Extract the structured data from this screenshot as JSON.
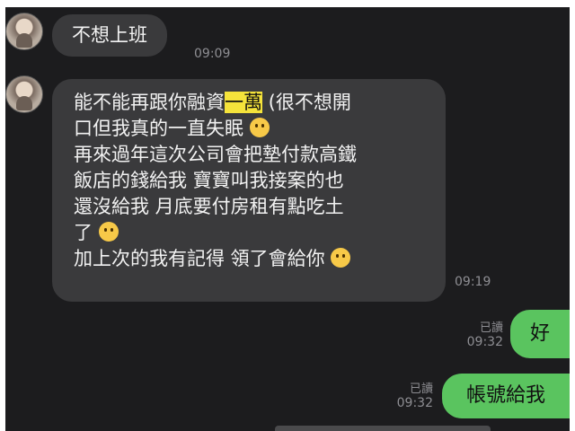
{
  "messages": {
    "m1": {
      "text": "不想上班",
      "time": "09:09"
    },
    "m2": {
      "line1_pre": "能不能再跟你融資",
      "line1_hl": "一萬",
      "line1_post": " (很不想開",
      "line2": "口但我真的一直失眠",
      "line3": "再來過年這次公司會把墊付款高鐵",
      "line4": "飯店的錢給我 寶寶叫我接案的也",
      "line5": "還沒給我 月底要付房租有點吃土",
      "line6": "了",
      "line7": "加上次的我有記得 領了會給你",
      "time": "09:19"
    },
    "m3": {
      "text": "好",
      "read": "已讀",
      "time": "09:32"
    },
    "m4": {
      "text": "帳號給我",
      "read": "已讀",
      "time": "09:32"
    }
  },
  "emojis": {
    "e1": "confused-face-icon",
    "e2": "pensive-face-icon",
    "e3": "crying-face-icon"
  },
  "colors": {
    "background": "#1c1c1e",
    "incoming_bubble": "#3a3a3c",
    "outgoing_bubble": "#5ac45f",
    "highlight": "#f5e33b"
  }
}
